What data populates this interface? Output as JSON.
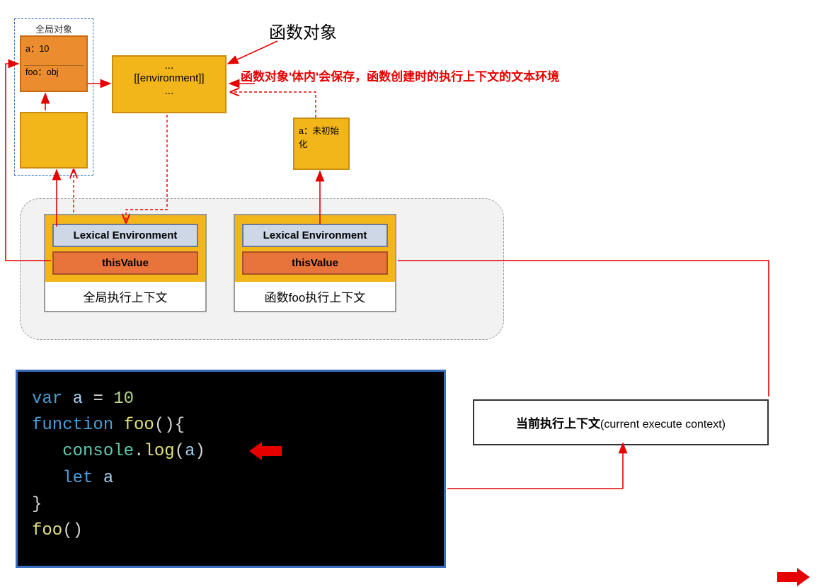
{
  "title_function_object": "函数对象",
  "red_annotation": "函数对象'体内'会保存，函数创建时的执行上下文的文本环境",
  "global_object_label": "全局对象",
  "global_object": {
    "a": "a：10",
    "foo": "foo：obj"
  },
  "environment_box": {
    "top": "...",
    "mid": "[[environment]]",
    "bot": "..."
  },
  "small_scope_box": "a：未初始\n化",
  "exec_ctx_global": {
    "lex": "Lexical Environment",
    "thisv": "thisValue",
    "label": "全局执行上下文"
  },
  "exec_ctx_foo": {
    "lex": "Lexical Environment",
    "thisv": "thisValue",
    "label": "函数foo执行上下文"
  },
  "current_ctx": {
    "zh": "当前执行上下文",
    "en": "(current  execute  context)"
  },
  "code": {
    "l1_var": "var",
    "l1_a": " a ",
    "l1_eq": "= ",
    "l1_num": "10",
    "l2_fn": "function",
    "l2_foo": " foo",
    "l2_par": "(){",
    "l3_indent": "   ",
    "l3_console": "console",
    "l3_dot": ".",
    "l3_log": "log",
    "l3_open": "(",
    "l3_a": "a",
    "l3_close": ")",
    "l4_indent": "   ",
    "l4_let": "let",
    "l4_a": " a",
    "l5": "}",
    "l6_foo": "foo",
    "l6_call": "()"
  }
}
